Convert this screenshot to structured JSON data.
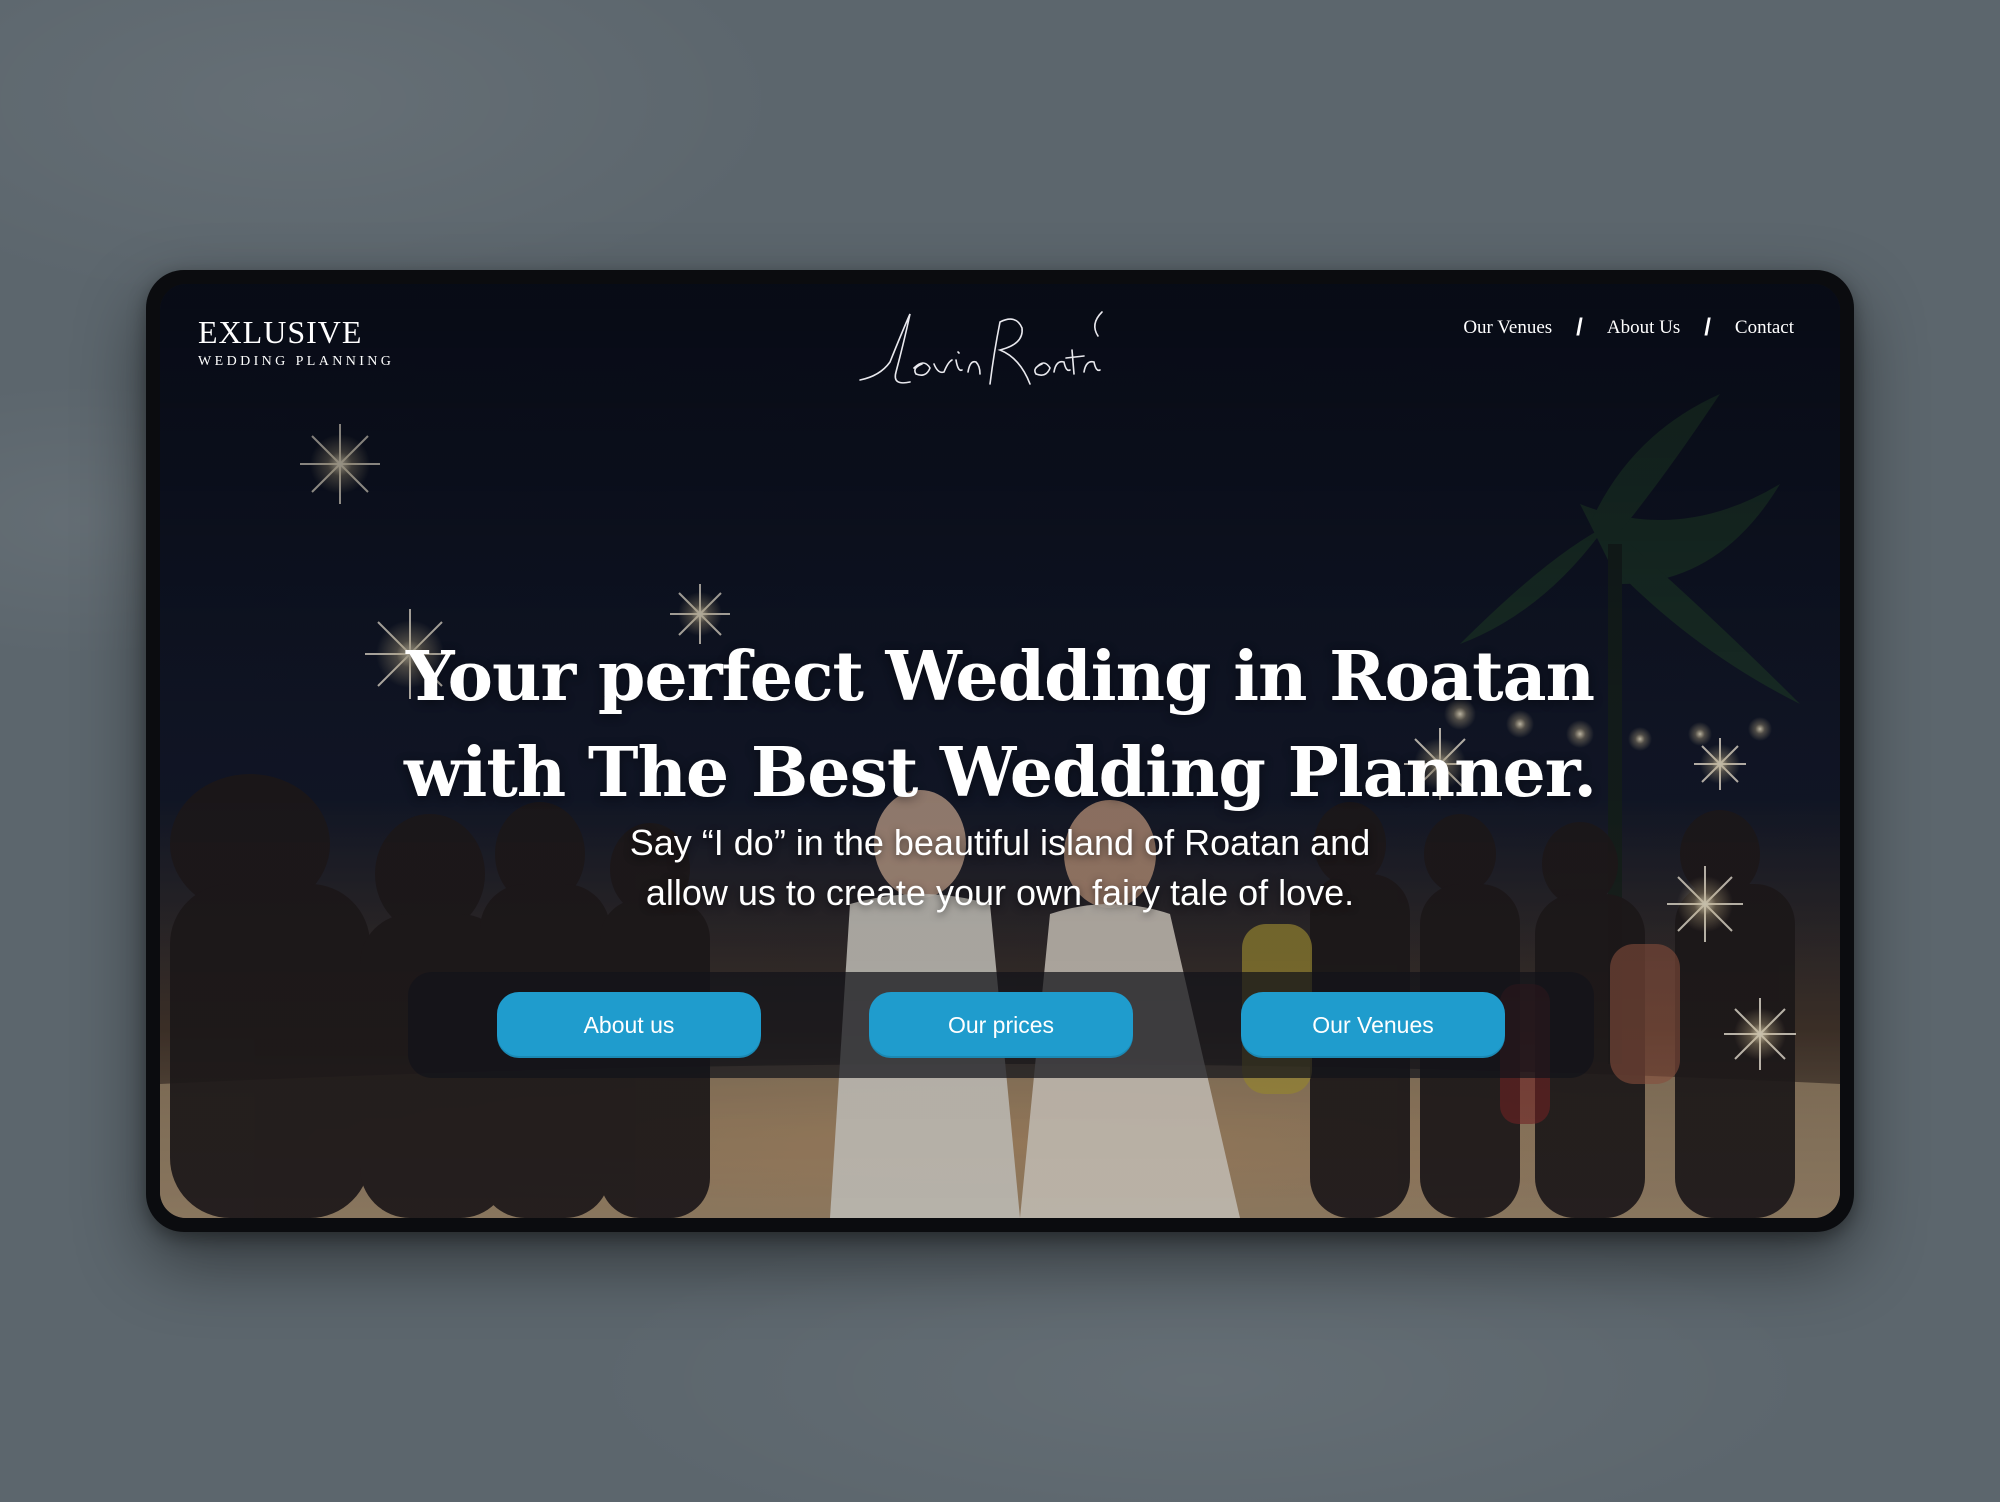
{
  "brand": {
    "title": "EXLUSIVE",
    "subtitle": "WEDDING PLANNING",
    "logo_script": "LovinRoatan"
  },
  "nav": {
    "items": [
      {
        "label": "Our Venues"
      },
      {
        "label": "About Us"
      },
      {
        "label": "Contact"
      }
    ],
    "separator": "/"
  },
  "hero": {
    "headline_line1": "Your perfect Wedding in Roatan",
    "headline_line2": "with The Best Wedding Planner.",
    "subtitle_line1": "Say “I do” in the beautiful island of Roatan and",
    "subtitle_line2": "allow us to create your own fairy tale of love.",
    "buttons": [
      {
        "label": "About us"
      },
      {
        "label": "Our prices"
      },
      {
        "label": "Our Venues"
      }
    ]
  },
  "colors": {
    "background": "#5c666d",
    "device_frame": "#0b0c0f",
    "button": "#1f9ccd",
    "text": "#ffffff"
  }
}
